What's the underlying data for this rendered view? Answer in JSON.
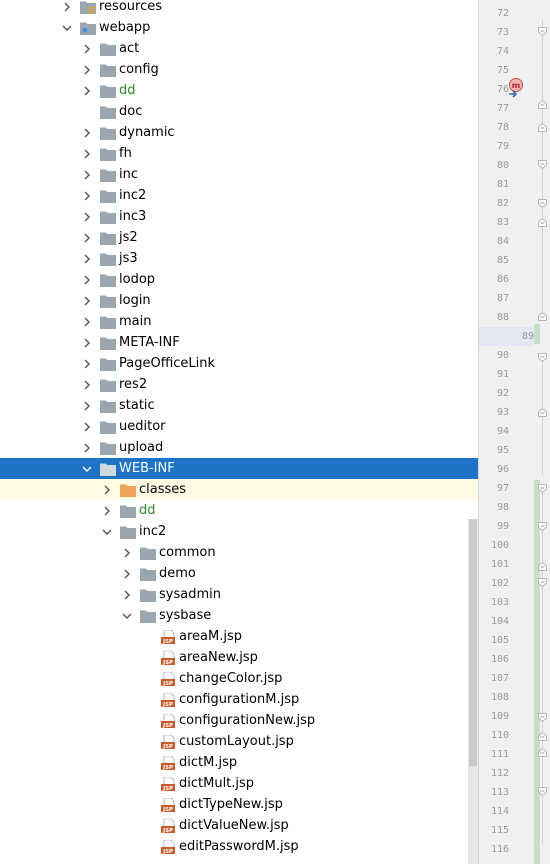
{
  "tree": {
    "rows": [
      {
        "label": "resources",
        "depth": 1,
        "arrow": "right",
        "icon": "resources-folder",
        "color": "normal",
        "state": ""
      },
      {
        "label": "webapp",
        "depth": 1,
        "arrow": "down",
        "icon": "web-folder",
        "color": "normal",
        "state": ""
      },
      {
        "label": "act",
        "depth": 2,
        "arrow": "right",
        "icon": "folder",
        "color": "normal",
        "state": ""
      },
      {
        "label": "config",
        "depth": 2,
        "arrow": "right",
        "icon": "folder",
        "color": "normal",
        "state": ""
      },
      {
        "label": "dd",
        "depth": 2,
        "arrow": "right",
        "icon": "folder",
        "color": "green",
        "state": ""
      },
      {
        "label": "doc",
        "depth": 2,
        "arrow": "none",
        "icon": "folder",
        "color": "normal",
        "state": ""
      },
      {
        "label": "dynamic",
        "depth": 2,
        "arrow": "right",
        "icon": "folder",
        "color": "normal",
        "state": ""
      },
      {
        "label": "fh",
        "depth": 2,
        "arrow": "right",
        "icon": "folder",
        "color": "normal",
        "state": ""
      },
      {
        "label": "inc",
        "depth": 2,
        "arrow": "right",
        "icon": "folder",
        "color": "normal",
        "state": ""
      },
      {
        "label": "inc2",
        "depth": 2,
        "arrow": "right",
        "icon": "folder",
        "color": "normal",
        "state": ""
      },
      {
        "label": "inc3",
        "depth": 2,
        "arrow": "right",
        "icon": "folder",
        "color": "normal",
        "state": ""
      },
      {
        "label": "js2",
        "depth": 2,
        "arrow": "right",
        "icon": "folder",
        "color": "normal",
        "state": ""
      },
      {
        "label": "js3",
        "depth": 2,
        "arrow": "right",
        "icon": "folder",
        "color": "normal",
        "state": ""
      },
      {
        "label": "lodop",
        "depth": 2,
        "arrow": "right",
        "icon": "folder",
        "color": "normal",
        "state": ""
      },
      {
        "label": "login",
        "depth": 2,
        "arrow": "right",
        "icon": "folder",
        "color": "normal",
        "state": ""
      },
      {
        "label": "main",
        "depth": 2,
        "arrow": "right",
        "icon": "folder",
        "color": "normal",
        "state": ""
      },
      {
        "label": "META-INF",
        "depth": 2,
        "arrow": "right",
        "icon": "folder",
        "color": "normal",
        "state": ""
      },
      {
        "label": "PageOfficeLink",
        "depth": 2,
        "arrow": "right",
        "icon": "folder",
        "color": "normal",
        "state": ""
      },
      {
        "label": "res2",
        "depth": 2,
        "arrow": "right",
        "icon": "folder",
        "color": "normal",
        "state": ""
      },
      {
        "label": "static",
        "depth": 2,
        "arrow": "right",
        "icon": "folder",
        "color": "normal",
        "state": ""
      },
      {
        "label": "ueditor",
        "depth": 2,
        "arrow": "right",
        "icon": "folder",
        "color": "normal",
        "state": ""
      },
      {
        "label": "upload",
        "depth": 2,
        "arrow": "right",
        "icon": "folder",
        "color": "normal",
        "state": ""
      },
      {
        "label": "WEB-INF",
        "depth": 2,
        "arrow": "down",
        "icon": "folder",
        "color": "normal",
        "state": "selected"
      },
      {
        "label": "classes",
        "depth": 3,
        "arrow": "right",
        "icon": "orange-folder",
        "color": "normal",
        "state": "hover"
      },
      {
        "label": "dd",
        "depth": 3,
        "arrow": "right",
        "icon": "folder",
        "color": "green",
        "state": ""
      },
      {
        "label": "inc2",
        "depth": 3,
        "arrow": "down",
        "icon": "folder",
        "color": "normal",
        "state": ""
      },
      {
        "label": "common",
        "depth": 4,
        "arrow": "right",
        "icon": "folder",
        "color": "normal",
        "state": ""
      },
      {
        "label": "demo",
        "depth": 4,
        "arrow": "right",
        "icon": "folder",
        "color": "normal",
        "state": ""
      },
      {
        "label": "sysadmin",
        "depth": 4,
        "arrow": "right",
        "icon": "folder",
        "color": "normal",
        "state": ""
      },
      {
        "label": "sysbase",
        "depth": 4,
        "arrow": "down",
        "icon": "folder",
        "color": "normal",
        "state": ""
      },
      {
        "label": "areaM.jsp",
        "depth": 5,
        "arrow": "none",
        "icon": "jsp-file",
        "color": "normal",
        "state": ""
      },
      {
        "label": "areaNew.jsp",
        "depth": 5,
        "arrow": "none",
        "icon": "jsp-file",
        "color": "normal",
        "state": ""
      },
      {
        "label": "changeColor.jsp",
        "depth": 5,
        "arrow": "none",
        "icon": "jsp-file",
        "color": "normal",
        "state": ""
      },
      {
        "label": "configurationM.jsp",
        "depth": 5,
        "arrow": "none",
        "icon": "jsp-file",
        "color": "normal",
        "state": ""
      },
      {
        "label": "configurationNew.jsp",
        "depth": 5,
        "arrow": "none",
        "icon": "jsp-file",
        "color": "normal",
        "state": ""
      },
      {
        "label": "customLayout.jsp",
        "depth": 5,
        "arrow": "none",
        "icon": "jsp-file",
        "color": "normal",
        "state": ""
      },
      {
        "label": "dictM.jsp",
        "depth": 5,
        "arrow": "none",
        "icon": "jsp-file",
        "color": "normal",
        "state": ""
      },
      {
        "label": "dictMult.jsp",
        "depth": 5,
        "arrow": "none",
        "icon": "jsp-file",
        "color": "normal",
        "state": ""
      },
      {
        "label": "dictTypeNew.jsp",
        "depth": 5,
        "arrow": "none",
        "icon": "jsp-file",
        "color": "normal",
        "state": ""
      },
      {
        "label": "dictValueNew.jsp",
        "depth": 5,
        "arrow": "none",
        "icon": "jsp-file",
        "color": "normal",
        "state": ""
      },
      {
        "label": "editPasswordM.jsp",
        "depth": 5,
        "arrow": "none",
        "icon": "jsp-file",
        "color": "normal",
        "state": ""
      }
    ]
  },
  "gutter": {
    "line_numbers": [
      "72",
      "73",
      "74",
      "75",
      "76",
      "77",
      "78",
      "79",
      "80",
      "81",
      "82",
      "83",
      "84",
      "85",
      "86",
      "87",
      "88",
      "89",
      "90",
      "91",
      "92",
      "93",
      "94",
      "95",
      "96",
      "97",
      "98",
      "99",
      "100",
      "101",
      "102",
      "103",
      "104",
      "105",
      "106",
      "107",
      "108",
      "109",
      "110",
      "111",
      "112",
      "113",
      "114",
      "115",
      "116"
    ],
    "current_line": "89",
    "method_marker": "m"
  },
  "colors": {
    "selection": "#1e73c7",
    "hover": "#fffbe4",
    "green_label": "#2d8a2d",
    "folder": "#9aa7b0",
    "orange_folder": "#f0a35a",
    "change_marker": "#c9dfc4"
  }
}
